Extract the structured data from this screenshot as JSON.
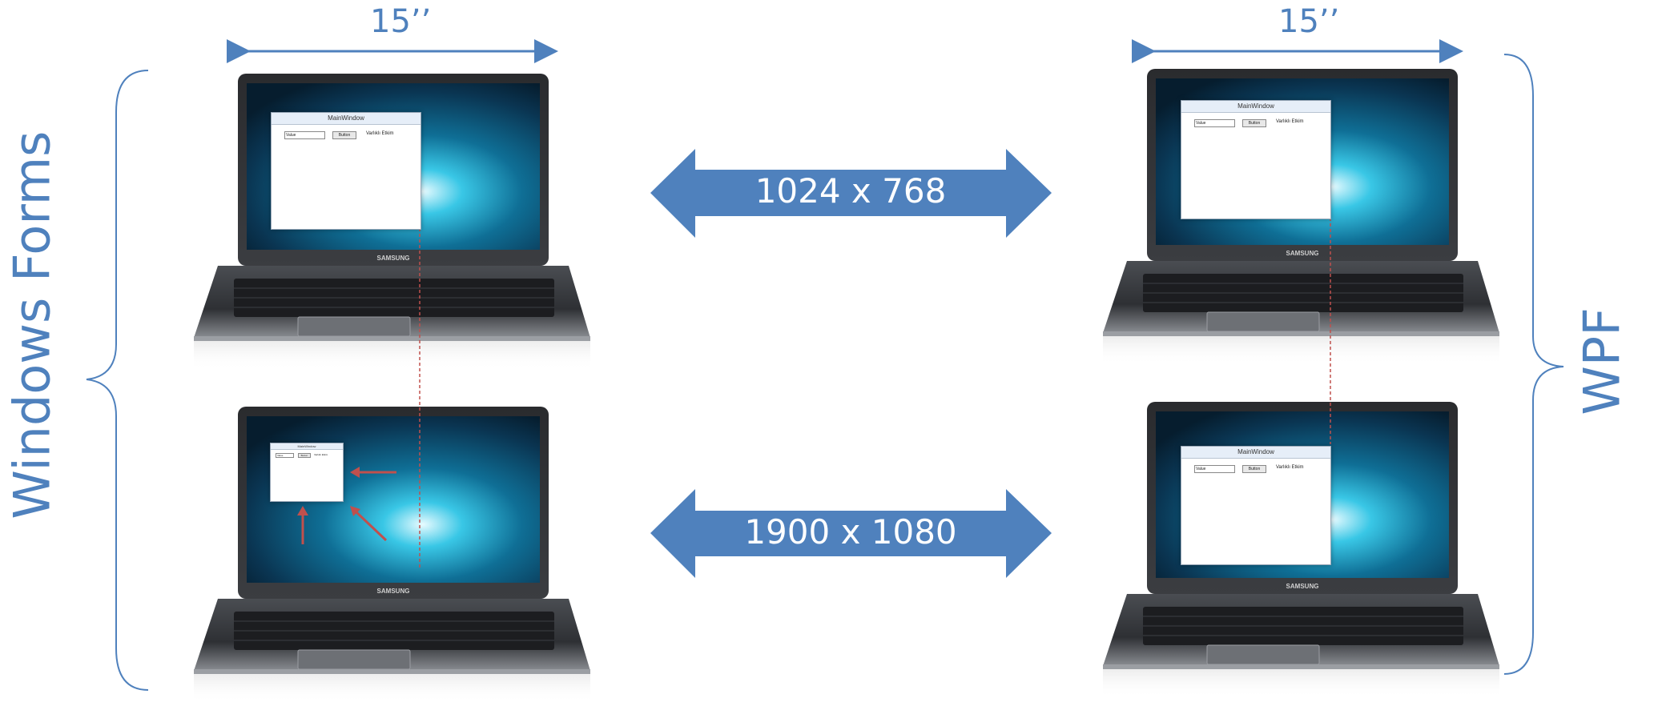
{
  "labels": {
    "left_width": "15’’",
    "right_width": "15’’",
    "left_side": "Windows Forms",
    "right_side": "WPF",
    "arrow_top": "1024 x 768",
    "arrow_bottom": "1900 x 1080"
  },
  "laptop": {
    "brand": "SAMSUNG"
  },
  "window": {
    "title": "MainWindow",
    "textbox": "Value",
    "button": "Button",
    "label": "Varlıklı Etkim"
  },
  "colors": {
    "accent_blue": "#4f81bd",
    "arrow_fill": "#4f81bd",
    "dashed_line": "#c0504d",
    "red_arrows": "#c0504d"
  }
}
